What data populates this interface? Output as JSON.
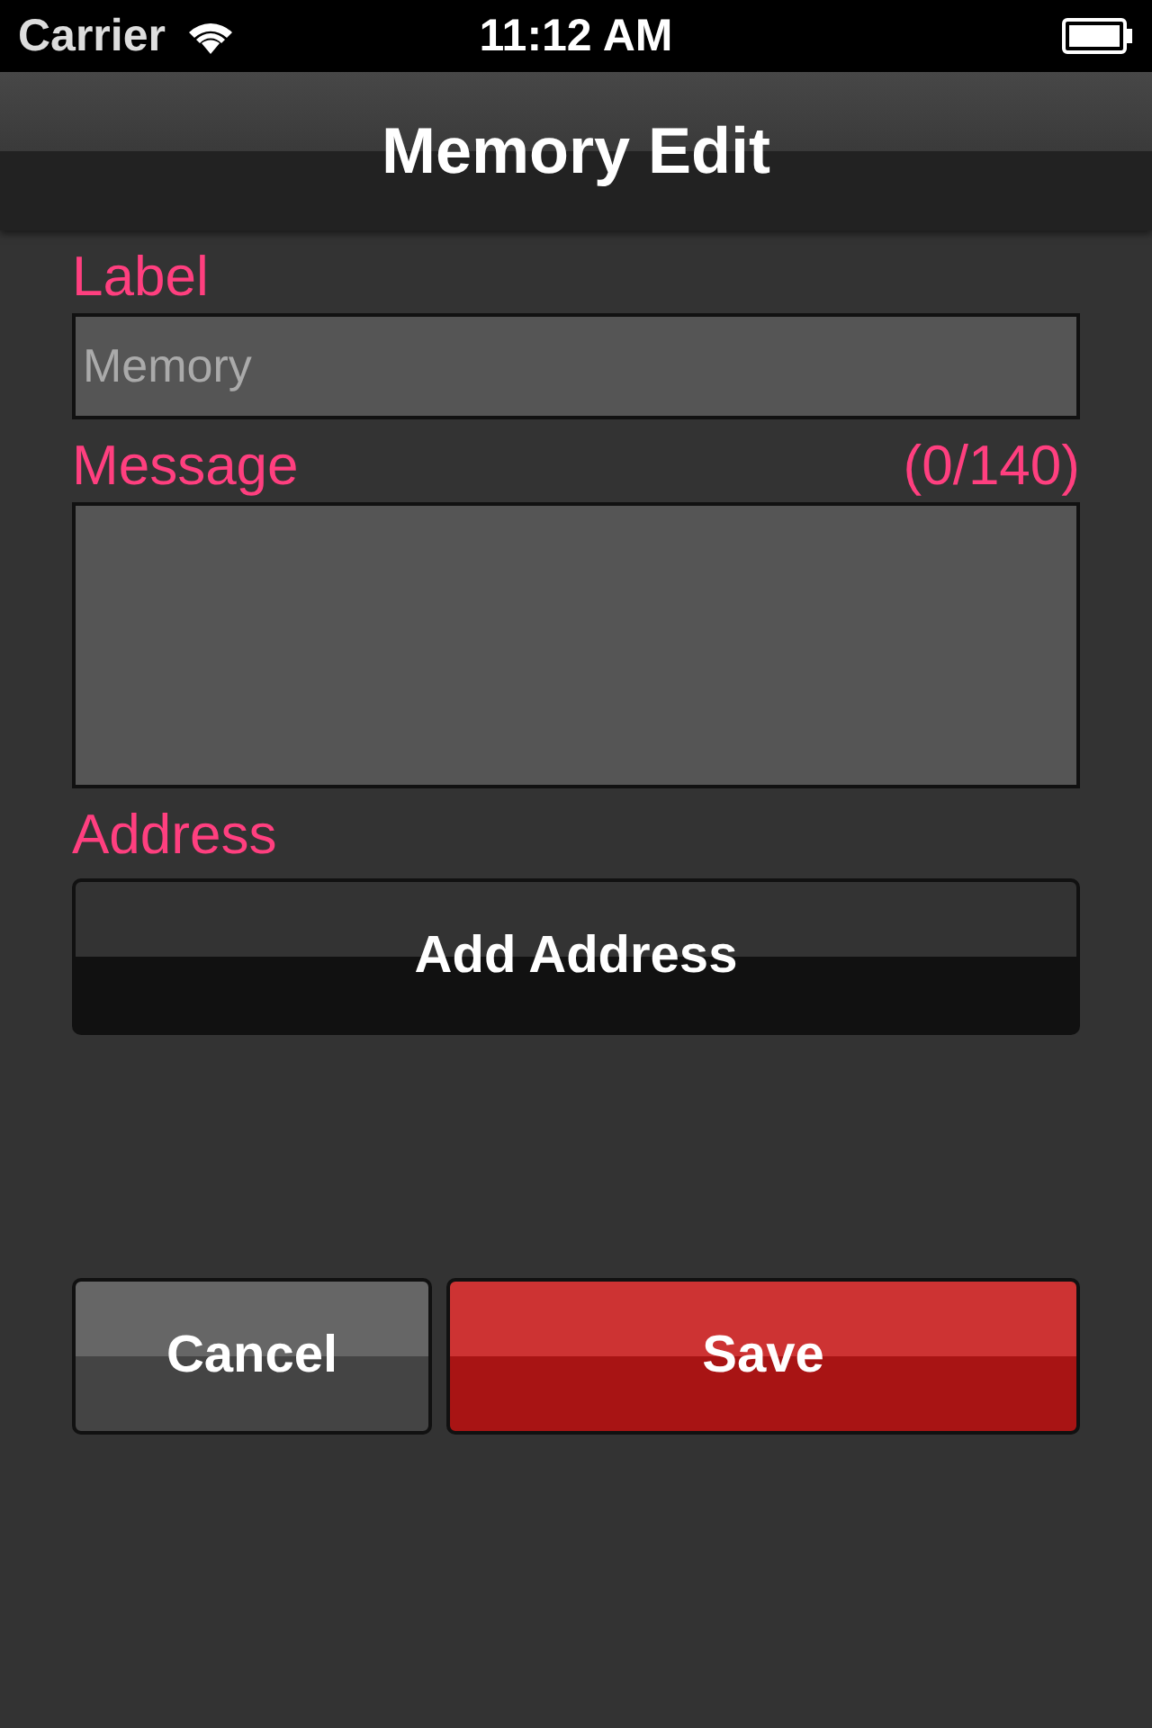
{
  "status_bar": {
    "carrier": "Carrier",
    "time": "11:12 AM"
  },
  "nav_bar": {
    "title": "Memory Edit"
  },
  "label_field": {
    "label": "Label",
    "placeholder": "Memory"
  },
  "message_field": {
    "label": "Message",
    "counter": "(0/140)"
  },
  "address": {
    "label": "Address",
    "button": "Add Address"
  },
  "buttons": [
    {
      "kind": "cancel",
      "label": "Cancel"
    },
    {
      "kind": "save",
      "label": "Save"
    }
  ]
}
